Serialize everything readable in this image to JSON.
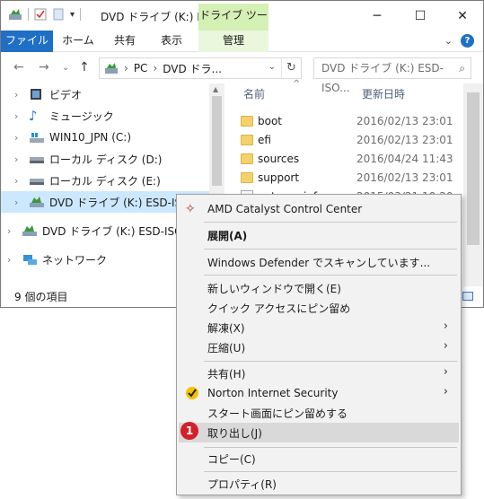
{
  "window": {
    "title": "DVD ドライブ (K:) ES...",
    "tool_tab": "ドライブ ツール",
    "minimize": "─",
    "maximize": "☐",
    "close": "✕"
  },
  "ribbon": {
    "tabs": [
      "ファイル",
      "ホーム",
      "共有",
      "表示",
      "管理"
    ],
    "help": "?"
  },
  "address": {
    "crumbs": [
      "PC",
      "›",
      "DVD ドラ..."
    ],
    "search_placeholder": "DVD ドライブ (K:) ESD-ISO..."
  },
  "nav_pane": {
    "items": [
      {
        "label": "ビデオ",
        "icon": "video-icon"
      },
      {
        "label": "ミュージック",
        "icon": "music-icon"
      },
      {
        "label": "WIN10_JPN (C:)",
        "icon": "windows-drive-icon"
      },
      {
        "label": "ローカル ディスク (D:)",
        "icon": "disk-icon"
      },
      {
        "label": "ローカル ディスク (E:)",
        "icon": "disk-icon"
      },
      {
        "label": "DVD ドライブ (K:) ESD-ISO",
        "icon": "dvd-icon"
      },
      {
        "label": "DVD ドライブ (K:) ESD-ISO",
        "icon": "dvd-icon"
      },
      {
        "label": "ネットワーク",
        "icon": "network-icon"
      }
    ]
  },
  "file_pane": {
    "col_name": "名前",
    "col_date": "更新日時",
    "rows": [
      {
        "name": "boot",
        "date": "2016/02/13 23:01"
      },
      {
        "name": "efi",
        "date": "2016/02/13 23:01"
      },
      {
        "name": "sources",
        "date": "2016/04/24 11:43"
      },
      {
        "name": "support",
        "date": "2016/02/13 23:01"
      },
      {
        "name": "autorun.inf",
        "date": "2015/03/21 10:20"
      }
    ]
  },
  "status": {
    "item_count": "9 個の項目"
  },
  "context_menu": {
    "items": [
      {
        "label": "AMD Catalyst Control Center"
      },
      {
        "label": "展開(A)",
        "bold": true
      },
      {
        "label": "Windows Defender でスキャンしています..."
      },
      {
        "label": "新しいウィンドウで開く(E)"
      },
      {
        "label": "クイック アクセスにピン留め"
      },
      {
        "label": "解凍(X)",
        "submenu": "›"
      },
      {
        "label": "圧縮(U)",
        "submenu": "›"
      },
      {
        "label": "共有(H)",
        "submenu": "›"
      },
      {
        "label": "Norton Internet Security",
        "submenu": "›"
      },
      {
        "label": "スタート画面にピン留めする"
      },
      {
        "label": "取り出し(J)"
      },
      {
        "label": "コピー(C)"
      },
      {
        "label": "プロパティ(R)"
      }
    ],
    "callout": "1"
  },
  "colors": {
    "accent": "#1f6fc5",
    "tool_tab": "#d4f0b4",
    "selected": "#cce8ff",
    "highlight": "#d9d9d9",
    "badge": "#d3202a"
  }
}
